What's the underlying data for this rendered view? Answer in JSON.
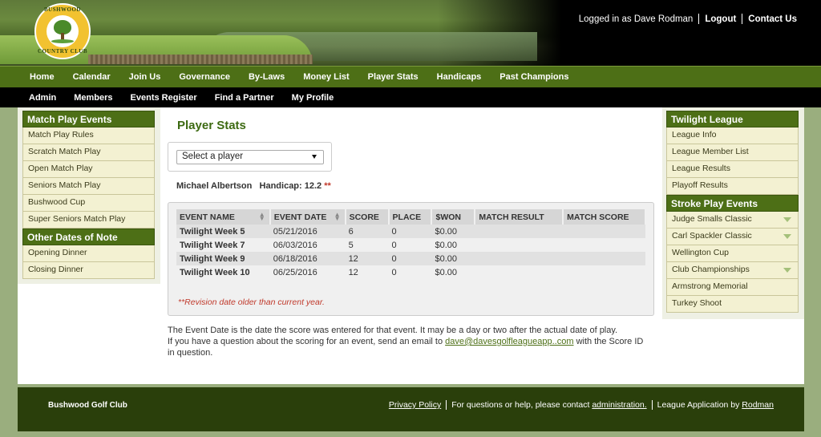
{
  "header": {
    "logo_text_top": "BUSHWOOD",
    "logo_text_bottom": "COUNTRY CLUB",
    "logged_in_text": "Logged in as Dave Rodman",
    "logout_label": "Logout",
    "contact_label": "Contact Us"
  },
  "nav_primary": [
    "Home",
    "Calendar",
    "Join Us",
    "Governance",
    "By-Laws",
    "Money List",
    "Player Stats",
    "Handicaps",
    "Past Champions"
  ],
  "nav_secondary": [
    "Admin",
    "Members",
    "Events Register",
    "Find a Partner",
    "My Profile"
  ],
  "left_sidebar": {
    "match_play_title": "Match Play Events",
    "match_play_items": [
      "Match Play Rules",
      "Scratch Match Play",
      "Open Match Play",
      "Seniors Match Play",
      "Bushwood Cup",
      "Super Seniors Match Play"
    ],
    "other_dates_title": "Other Dates of Note",
    "other_dates_items": [
      "Opening Dinner",
      "Closing Dinner"
    ]
  },
  "right_sidebar": {
    "twilight_title": "Twilight League",
    "twilight_items": [
      "League Info",
      "League Member List",
      "League Results",
      "Playoff Results"
    ],
    "stroke_title": "Stroke Play Events",
    "stroke_items": [
      {
        "label": "Judge Smalls Classic",
        "expandable": true
      },
      {
        "label": "Carl Spackler Classic",
        "expandable": true
      },
      {
        "label": "Wellington Cup",
        "expandable": false
      },
      {
        "label": "Club Championships",
        "expandable": true
      },
      {
        "label": "Armstrong Memorial",
        "expandable": false
      },
      {
        "label": "Turkey Shoot",
        "expandable": false
      }
    ]
  },
  "content": {
    "page_title": "Player Stats",
    "select_value": "Select a player",
    "player_name": "Michael Albertson",
    "handicap_label": "Handicap: 12.2",
    "handicap_flag": "**",
    "table_headers": [
      "EVENT NAME",
      "EVENT DATE",
      "SCORE",
      "PLACE",
      "$WON",
      "MATCH RESULT",
      "MATCH SCORE"
    ],
    "rows": [
      [
        "Twilight Week 5",
        "05/21/2016",
        "6",
        "0",
        "$0.00",
        "",
        ""
      ],
      [
        "Twilight Week 7",
        "06/03/2016",
        "5",
        "0",
        "$0.00",
        "",
        ""
      ],
      [
        "Twilight Week 9",
        "06/18/2016",
        "12",
        "0",
        "$0.00",
        "",
        ""
      ],
      [
        "Twilight Week 10",
        "06/25/2016",
        "12",
        "0",
        "$0.00",
        "",
        ""
      ]
    ],
    "revision_note": "**Revision date older than current year.",
    "footnote_line1": "The Event Date is the date the score was entered for that event. It may be a day or two after the actual date of play.",
    "footnote_line2_pre": "If you have a question about the scoring for an event, send an email to ",
    "footnote_email": "dave@davesgolfleagueapp..com",
    "footnote_line2_post": " with the Score ID in question."
  },
  "footer": {
    "club_name": "Bushwood Golf Club",
    "privacy_label": "Privacy Policy",
    "help_text": "For questions or help, please contact ",
    "admin_link": "administration.",
    "app_text": "League Application by ",
    "app_link": "Rodman"
  },
  "colors": {
    "nav_green": "#4d6f16",
    "title_green": "#3d6a12",
    "footer_green": "#2a3f0b",
    "page_bg": "#9aae7e"
  }
}
